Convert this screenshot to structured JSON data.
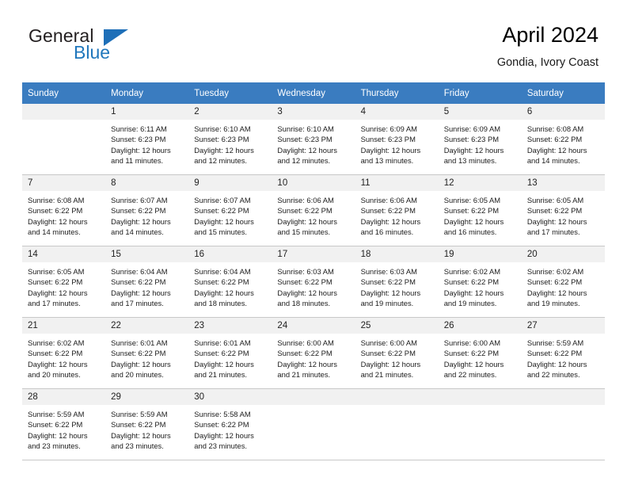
{
  "brand": {
    "name_part1": "General",
    "name_part2": "Blue",
    "triangle_icon": "blue-triangle-logo-mark"
  },
  "header": {
    "title": "April 2024",
    "subtitle": "Gondia, Ivory Coast"
  },
  "colors": {
    "header_blue": "#3a7cc0",
    "brand_blue": "#2077bc",
    "daynum_band": "#f1f1f1",
    "row_divider": "#c8c8c8"
  },
  "weekday_headers": [
    "Sunday",
    "Monday",
    "Tuesday",
    "Wednesday",
    "Thursday",
    "Friday",
    "Saturday"
  ],
  "weeks": [
    [
      {
        "day": "",
        "empty": true,
        "sunrise": "",
        "sunset": "",
        "daylight_line1": "",
        "daylight_line2": ""
      },
      {
        "day": "1",
        "empty": false,
        "sunrise": "Sunrise: 6:11 AM",
        "sunset": "Sunset: 6:23 PM",
        "daylight_line1": "Daylight: 12 hours",
        "daylight_line2": "and 11 minutes."
      },
      {
        "day": "2",
        "empty": false,
        "sunrise": "Sunrise: 6:10 AM",
        "sunset": "Sunset: 6:23 PM",
        "daylight_line1": "Daylight: 12 hours",
        "daylight_line2": "and 12 minutes."
      },
      {
        "day": "3",
        "empty": false,
        "sunrise": "Sunrise: 6:10 AM",
        "sunset": "Sunset: 6:23 PM",
        "daylight_line1": "Daylight: 12 hours",
        "daylight_line2": "and 12 minutes."
      },
      {
        "day": "4",
        "empty": false,
        "sunrise": "Sunrise: 6:09 AM",
        "sunset": "Sunset: 6:23 PM",
        "daylight_line1": "Daylight: 12 hours",
        "daylight_line2": "and 13 minutes."
      },
      {
        "day": "5",
        "empty": false,
        "sunrise": "Sunrise: 6:09 AM",
        "sunset": "Sunset: 6:23 PM",
        "daylight_line1": "Daylight: 12 hours",
        "daylight_line2": "and 13 minutes."
      },
      {
        "day": "6",
        "empty": false,
        "sunrise": "Sunrise: 6:08 AM",
        "sunset": "Sunset: 6:22 PM",
        "daylight_line1": "Daylight: 12 hours",
        "daylight_line2": "and 14 minutes."
      }
    ],
    [
      {
        "day": "7",
        "empty": false,
        "sunrise": "Sunrise: 6:08 AM",
        "sunset": "Sunset: 6:22 PM",
        "daylight_line1": "Daylight: 12 hours",
        "daylight_line2": "and 14 minutes."
      },
      {
        "day": "8",
        "empty": false,
        "sunrise": "Sunrise: 6:07 AM",
        "sunset": "Sunset: 6:22 PM",
        "daylight_line1": "Daylight: 12 hours",
        "daylight_line2": "and 14 minutes."
      },
      {
        "day": "9",
        "empty": false,
        "sunrise": "Sunrise: 6:07 AM",
        "sunset": "Sunset: 6:22 PM",
        "daylight_line1": "Daylight: 12 hours",
        "daylight_line2": "and 15 minutes."
      },
      {
        "day": "10",
        "empty": false,
        "sunrise": "Sunrise: 6:06 AM",
        "sunset": "Sunset: 6:22 PM",
        "daylight_line1": "Daylight: 12 hours",
        "daylight_line2": "and 15 minutes."
      },
      {
        "day": "11",
        "empty": false,
        "sunrise": "Sunrise: 6:06 AM",
        "sunset": "Sunset: 6:22 PM",
        "daylight_line1": "Daylight: 12 hours",
        "daylight_line2": "and 16 minutes."
      },
      {
        "day": "12",
        "empty": false,
        "sunrise": "Sunrise: 6:05 AM",
        "sunset": "Sunset: 6:22 PM",
        "daylight_line1": "Daylight: 12 hours",
        "daylight_line2": "and 16 minutes."
      },
      {
        "day": "13",
        "empty": false,
        "sunrise": "Sunrise: 6:05 AM",
        "sunset": "Sunset: 6:22 PM",
        "daylight_line1": "Daylight: 12 hours",
        "daylight_line2": "and 17 minutes."
      }
    ],
    [
      {
        "day": "14",
        "empty": false,
        "sunrise": "Sunrise: 6:05 AM",
        "sunset": "Sunset: 6:22 PM",
        "daylight_line1": "Daylight: 12 hours",
        "daylight_line2": "and 17 minutes."
      },
      {
        "day": "15",
        "empty": false,
        "sunrise": "Sunrise: 6:04 AM",
        "sunset": "Sunset: 6:22 PM",
        "daylight_line1": "Daylight: 12 hours",
        "daylight_line2": "and 17 minutes."
      },
      {
        "day": "16",
        "empty": false,
        "sunrise": "Sunrise: 6:04 AM",
        "sunset": "Sunset: 6:22 PM",
        "daylight_line1": "Daylight: 12 hours",
        "daylight_line2": "and 18 minutes."
      },
      {
        "day": "17",
        "empty": false,
        "sunrise": "Sunrise: 6:03 AM",
        "sunset": "Sunset: 6:22 PM",
        "daylight_line1": "Daylight: 12 hours",
        "daylight_line2": "and 18 minutes."
      },
      {
        "day": "18",
        "empty": false,
        "sunrise": "Sunrise: 6:03 AM",
        "sunset": "Sunset: 6:22 PM",
        "daylight_line1": "Daylight: 12 hours",
        "daylight_line2": "and 19 minutes."
      },
      {
        "day": "19",
        "empty": false,
        "sunrise": "Sunrise: 6:02 AM",
        "sunset": "Sunset: 6:22 PM",
        "daylight_line1": "Daylight: 12 hours",
        "daylight_line2": "and 19 minutes."
      },
      {
        "day": "20",
        "empty": false,
        "sunrise": "Sunrise: 6:02 AM",
        "sunset": "Sunset: 6:22 PM",
        "daylight_line1": "Daylight: 12 hours",
        "daylight_line2": "and 19 minutes."
      }
    ],
    [
      {
        "day": "21",
        "empty": false,
        "sunrise": "Sunrise: 6:02 AM",
        "sunset": "Sunset: 6:22 PM",
        "daylight_line1": "Daylight: 12 hours",
        "daylight_line2": "and 20 minutes."
      },
      {
        "day": "22",
        "empty": false,
        "sunrise": "Sunrise: 6:01 AM",
        "sunset": "Sunset: 6:22 PM",
        "daylight_line1": "Daylight: 12 hours",
        "daylight_line2": "and 20 minutes."
      },
      {
        "day": "23",
        "empty": false,
        "sunrise": "Sunrise: 6:01 AM",
        "sunset": "Sunset: 6:22 PM",
        "daylight_line1": "Daylight: 12 hours",
        "daylight_line2": "and 21 minutes."
      },
      {
        "day": "24",
        "empty": false,
        "sunrise": "Sunrise: 6:00 AM",
        "sunset": "Sunset: 6:22 PM",
        "daylight_line1": "Daylight: 12 hours",
        "daylight_line2": "and 21 minutes."
      },
      {
        "day": "25",
        "empty": false,
        "sunrise": "Sunrise: 6:00 AM",
        "sunset": "Sunset: 6:22 PM",
        "daylight_line1": "Daylight: 12 hours",
        "daylight_line2": "and 21 minutes."
      },
      {
        "day": "26",
        "empty": false,
        "sunrise": "Sunrise: 6:00 AM",
        "sunset": "Sunset: 6:22 PM",
        "daylight_line1": "Daylight: 12 hours",
        "daylight_line2": "and 22 minutes."
      },
      {
        "day": "27",
        "empty": false,
        "sunrise": "Sunrise: 5:59 AM",
        "sunset": "Sunset: 6:22 PM",
        "daylight_line1": "Daylight: 12 hours",
        "daylight_line2": "and 22 minutes."
      }
    ],
    [
      {
        "day": "28",
        "empty": false,
        "sunrise": "Sunrise: 5:59 AM",
        "sunset": "Sunset: 6:22 PM",
        "daylight_line1": "Daylight: 12 hours",
        "daylight_line2": "and 23 minutes."
      },
      {
        "day": "29",
        "empty": false,
        "sunrise": "Sunrise: 5:59 AM",
        "sunset": "Sunset: 6:22 PM",
        "daylight_line1": "Daylight: 12 hours",
        "daylight_line2": "and 23 minutes."
      },
      {
        "day": "30",
        "empty": false,
        "sunrise": "Sunrise: 5:58 AM",
        "sunset": "Sunset: 6:22 PM",
        "daylight_line1": "Daylight: 12 hours",
        "daylight_line2": "and 23 minutes."
      },
      {
        "day": "",
        "empty": true,
        "sunrise": "",
        "sunset": "",
        "daylight_line1": "",
        "daylight_line2": ""
      },
      {
        "day": "",
        "empty": true,
        "sunrise": "",
        "sunset": "",
        "daylight_line1": "",
        "daylight_line2": ""
      },
      {
        "day": "",
        "empty": true,
        "sunrise": "",
        "sunset": "",
        "daylight_line1": "",
        "daylight_line2": ""
      },
      {
        "day": "",
        "empty": true,
        "sunrise": "",
        "sunset": "",
        "daylight_line1": "",
        "daylight_line2": ""
      }
    ]
  ]
}
